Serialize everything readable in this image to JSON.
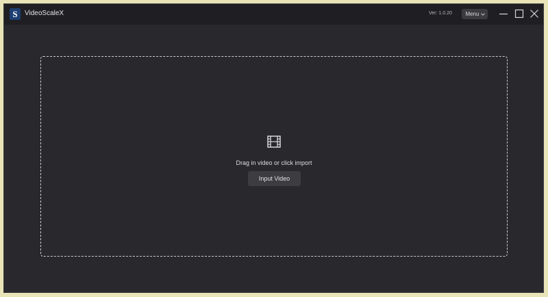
{
  "app": {
    "logo_letter": "S",
    "title": "VideoScaleX",
    "version": "Ver: 1.0.20",
    "menu_label": "Menu"
  },
  "window_controls": {
    "minimize_icon": "minimize-icon",
    "maximize_icon": "maximize-icon",
    "close_icon": "close-icon"
  },
  "dropzone": {
    "icon": "film-icon",
    "hint": "Drag in video or click import",
    "button_label": "Input Video"
  },
  "colors": {
    "window_bg": "#29282d",
    "titlebar_bg": "#1f1f23",
    "logo_bg": "#1d3f73",
    "button_bg": "#3c3c41",
    "outer_border": "#e9e4b8"
  }
}
